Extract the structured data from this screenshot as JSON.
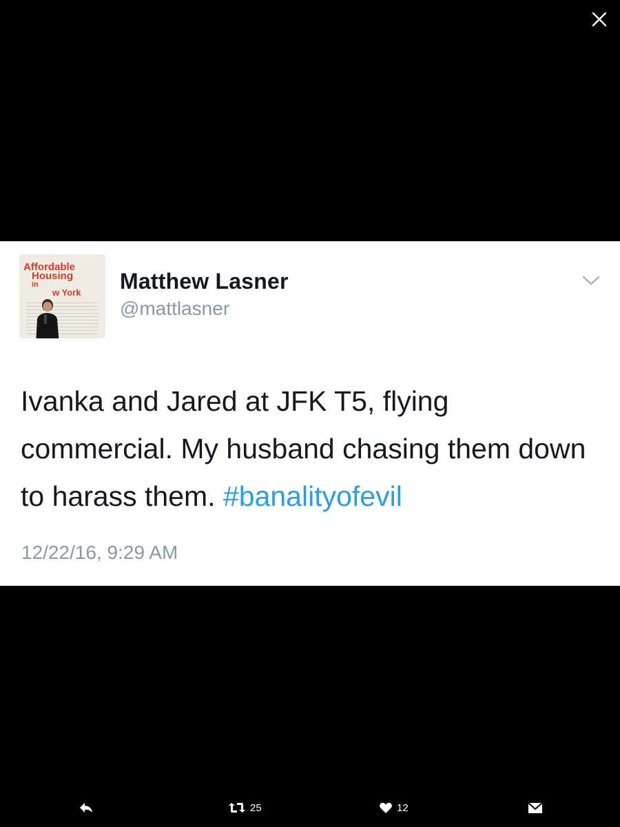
{
  "tweet": {
    "author_name": "Matthew Lasner",
    "author_handle": "@mattlasner",
    "avatar_text": [
      "Affordable",
      "Housing",
      "in",
      "w York"
    ],
    "text_plain": "Ivanka and Jared at JFK T5, flying commercial. My husband chasing them down to harass them. ",
    "hashtag": "#banalityofevil",
    "timestamp": "12/22/16, 9:29 AM"
  },
  "actions": {
    "retweet_count": "25",
    "like_count": "12"
  },
  "icons": {
    "close": "close-icon",
    "caret": "chevron-down-icon",
    "reply": "reply-icon",
    "retweet": "retweet-icon",
    "like": "heart-icon",
    "message": "envelope-icon"
  },
  "colors": {
    "background": "#000000",
    "card": "#ffffff",
    "text": "#141823",
    "secondary": "#8899a6",
    "link": "#2a9ce8"
  }
}
